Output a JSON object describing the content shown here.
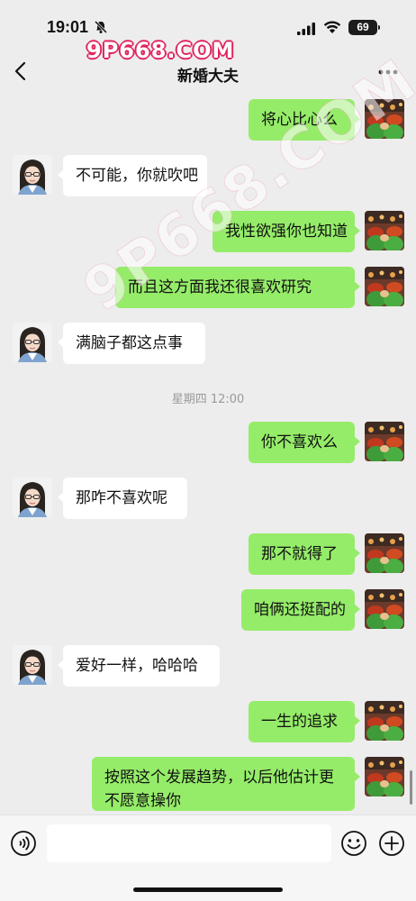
{
  "status_bar": {
    "time": "19:01",
    "battery": "69",
    "icons": [
      "bell-muted-icon",
      "signal-icon",
      "wifi-icon",
      "battery-icon"
    ]
  },
  "watermark": {
    "top": "9P668.COM",
    "diagonal": "9P668.COM"
  },
  "header": {
    "title": "新婚大夫",
    "back_icon": "chevron-left-icon",
    "more_icon": "more-dots-icon"
  },
  "messages": [
    {
      "side": "out",
      "text": "将心比心么"
    },
    {
      "side": "in",
      "text": "不可能，你就吹吧"
    },
    {
      "side": "out",
      "text": "我性欲强你也知道"
    },
    {
      "side": "out",
      "text": "而且这方面我还很喜欢研究"
    },
    {
      "side": "in",
      "text": "满脑子都这点事"
    },
    {
      "side": "out",
      "text": "你不喜欢么"
    },
    {
      "side": "in",
      "text": "那咋不喜欢呢"
    },
    {
      "side": "out",
      "text": "那不就得了"
    },
    {
      "side": "out",
      "text": "咱俩还挺配的"
    },
    {
      "side": "in",
      "text": "爱好一样，哈哈哈"
    },
    {
      "side": "out",
      "text": "一生的追求"
    },
    {
      "side": "out",
      "text": "按照这个发展趋势，以后他估计更不愿意操你"
    }
  ],
  "timestamp": "星期四 12:00",
  "input_bar": {
    "placeholder": "",
    "voice_icon": "voice-icon",
    "emoji_icon": "emoji-icon",
    "plus_icon": "plus-icon"
  },
  "colors": {
    "background": "#ededed",
    "outgoing_bubble": "#95ec69",
    "incoming_bubble": "#ffffff",
    "watermark": "#e0245e"
  }
}
